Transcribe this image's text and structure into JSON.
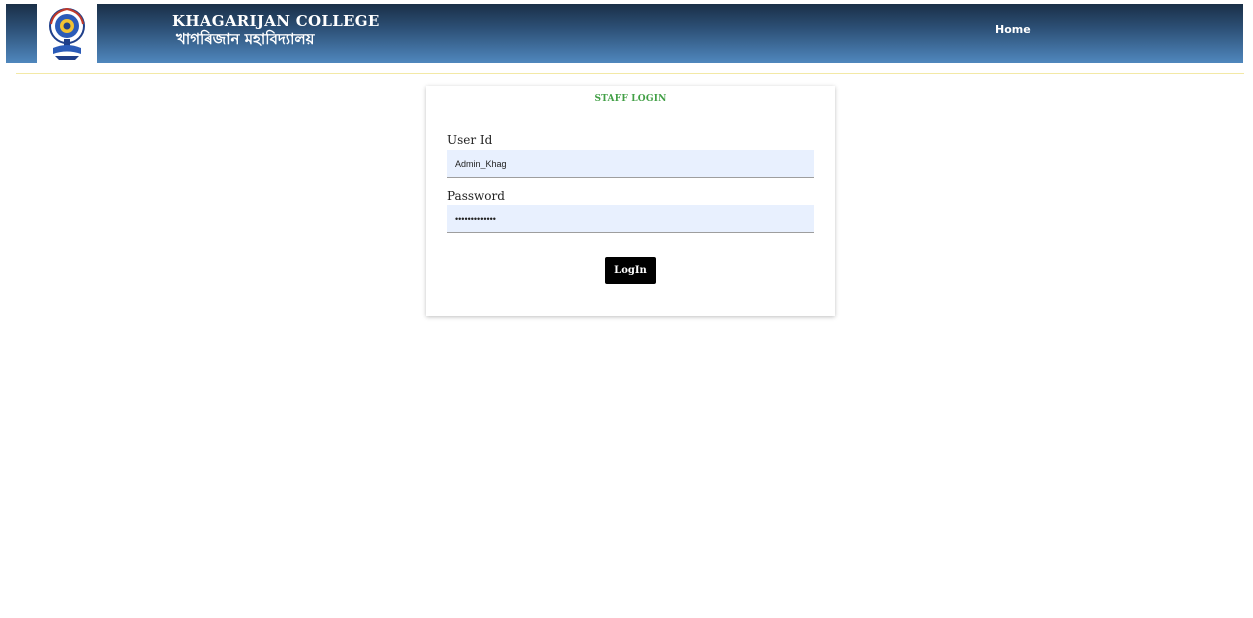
{
  "header": {
    "college_name_en": "KHAGARIJAN COLLEGE",
    "college_name_as": "খাগৰিজান মহাবিদ্যালয়",
    "logo_icon": "college-emblem-icon",
    "nav": {
      "home_label": "Home"
    }
  },
  "login": {
    "title": "STAFF LOGIN",
    "user_id_label": "User Id",
    "user_id_value": "Admin_Khag",
    "password_label": "Password",
    "password_value": "Khagarijan@22",
    "button_label": "LogIn"
  },
  "colors": {
    "header_dark": "#1a2f47",
    "header_light": "#4f87bd",
    "title_green": "#43a047",
    "input_bg": "#e8f0fe",
    "divider": "#f3e9a6"
  }
}
